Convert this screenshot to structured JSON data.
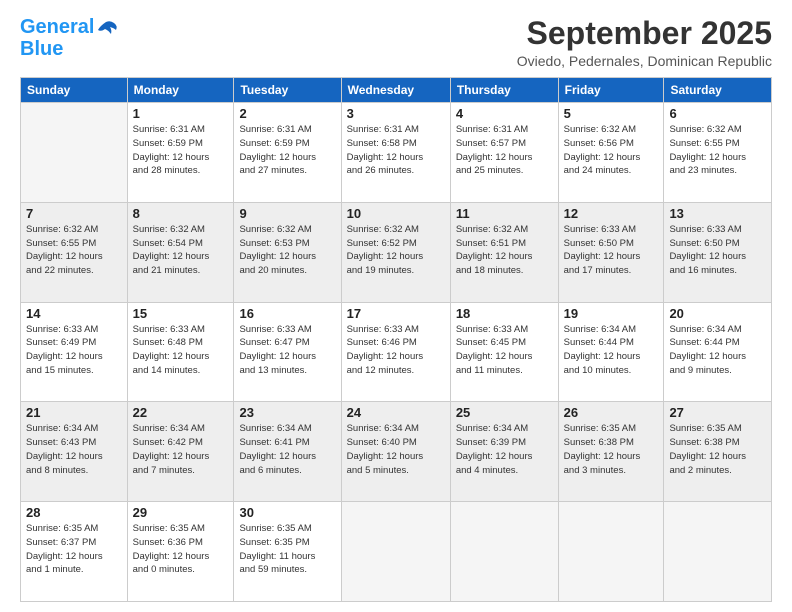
{
  "logo": {
    "line1": "General",
    "line2": "Blue"
  },
  "title": "September 2025",
  "subtitle": "Oviedo, Pedernales, Dominican Republic",
  "days_of_week": [
    "Sunday",
    "Monday",
    "Tuesday",
    "Wednesday",
    "Thursday",
    "Friday",
    "Saturday"
  ],
  "weeks": [
    [
      {
        "num": "",
        "info": ""
      },
      {
        "num": "1",
        "info": "Sunrise: 6:31 AM\nSunset: 6:59 PM\nDaylight: 12 hours\nand 28 minutes."
      },
      {
        "num": "2",
        "info": "Sunrise: 6:31 AM\nSunset: 6:59 PM\nDaylight: 12 hours\nand 27 minutes."
      },
      {
        "num": "3",
        "info": "Sunrise: 6:31 AM\nSunset: 6:58 PM\nDaylight: 12 hours\nand 26 minutes."
      },
      {
        "num": "4",
        "info": "Sunrise: 6:31 AM\nSunset: 6:57 PM\nDaylight: 12 hours\nand 25 minutes."
      },
      {
        "num": "5",
        "info": "Sunrise: 6:32 AM\nSunset: 6:56 PM\nDaylight: 12 hours\nand 24 minutes."
      },
      {
        "num": "6",
        "info": "Sunrise: 6:32 AM\nSunset: 6:55 PM\nDaylight: 12 hours\nand 23 minutes."
      }
    ],
    [
      {
        "num": "7",
        "info": "Sunrise: 6:32 AM\nSunset: 6:55 PM\nDaylight: 12 hours\nand 22 minutes."
      },
      {
        "num": "8",
        "info": "Sunrise: 6:32 AM\nSunset: 6:54 PM\nDaylight: 12 hours\nand 21 minutes."
      },
      {
        "num": "9",
        "info": "Sunrise: 6:32 AM\nSunset: 6:53 PM\nDaylight: 12 hours\nand 20 minutes."
      },
      {
        "num": "10",
        "info": "Sunrise: 6:32 AM\nSunset: 6:52 PM\nDaylight: 12 hours\nand 19 minutes."
      },
      {
        "num": "11",
        "info": "Sunrise: 6:32 AM\nSunset: 6:51 PM\nDaylight: 12 hours\nand 18 minutes."
      },
      {
        "num": "12",
        "info": "Sunrise: 6:33 AM\nSunset: 6:50 PM\nDaylight: 12 hours\nand 17 minutes."
      },
      {
        "num": "13",
        "info": "Sunrise: 6:33 AM\nSunset: 6:50 PM\nDaylight: 12 hours\nand 16 minutes."
      }
    ],
    [
      {
        "num": "14",
        "info": "Sunrise: 6:33 AM\nSunset: 6:49 PM\nDaylight: 12 hours\nand 15 minutes."
      },
      {
        "num": "15",
        "info": "Sunrise: 6:33 AM\nSunset: 6:48 PM\nDaylight: 12 hours\nand 14 minutes."
      },
      {
        "num": "16",
        "info": "Sunrise: 6:33 AM\nSunset: 6:47 PM\nDaylight: 12 hours\nand 13 minutes."
      },
      {
        "num": "17",
        "info": "Sunrise: 6:33 AM\nSunset: 6:46 PM\nDaylight: 12 hours\nand 12 minutes."
      },
      {
        "num": "18",
        "info": "Sunrise: 6:33 AM\nSunset: 6:45 PM\nDaylight: 12 hours\nand 11 minutes."
      },
      {
        "num": "19",
        "info": "Sunrise: 6:34 AM\nSunset: 6:44 PM\nDaylight: 12 hours\nand 10 minutes."
      },
      {
        "num": "20",
        "info": "Sunrise: 6:34 AM\nSunset: 6:44 PM\nDaylight: 12 hours\nand 9 minutes."
      }
    ],
    [
      {
        "num": "21",
        "info": "Sunrise: 6:34 AM\nSunset: 6:43 PM\nDaylight: 12 hours\nand 8 minutes."
      },
      {
        "num": "22",
        "info": "Sunrise: 6:34 AM\nSunset: 6:42 PM\nDaylight: 12 hours\nand 7 minutes."
      },
      {
        "num": "23",
        "info": "Sunrise: 6:34 AM\nSunset: 6:41 PM\nDaylight: 12 hours\nand 6 minutes."
      },
      {
        "num": "24",
        "info": "Sunrise: 6:34 AM\nSunset: 6:40 PM\nDaylight: 12 hours\nand 5 minutes."
      },
      {
        "num": "25",
        "info": "Sunrise: 6:34 AM\nSunset: 6:39 PM\nDaylight: 12 hours\nand 4 minutes."
      },
      {
        "num": "26",
        "info": "Sunrise: 6:35 AM\nSunset: 6:38 PM\nDaylight: 12 hours\nand 3 minutes."
      },
      {
        "num": "27",
        "info": "Sunrise: 6:35 AM\nSunset: 6:38 PM\nDaylight: 12 hours\nand 2 minutes."
      }
    ],
    [
      {
        "num": "28",
        "info": "Sunrise: 6:35 AM\nSunset: 6:37 PM\nDaylight: 12 hours\nand 1 minute."
      },
      {
        "num": "29",
        "info": "Sunrise: 6:35 AM\nSunset: 6:36 PM\nDaylight: 12 hours\nand 0 minutes."
      },
      {
        "num": "30",
        "info": "Sunrise: 6:35 AM\nSunset: 6:35 PM\nDaylight: 11 hours\nand 59 minutes."
      },
      {
        "num": "",
        "info": ""
      },
      {
        "num": "",
        "info": ""
      },
      {
        "num": "",
        "info": ""
      },
      {
        "num": "",
        "info": ""
      }
    ]
  ]
}
